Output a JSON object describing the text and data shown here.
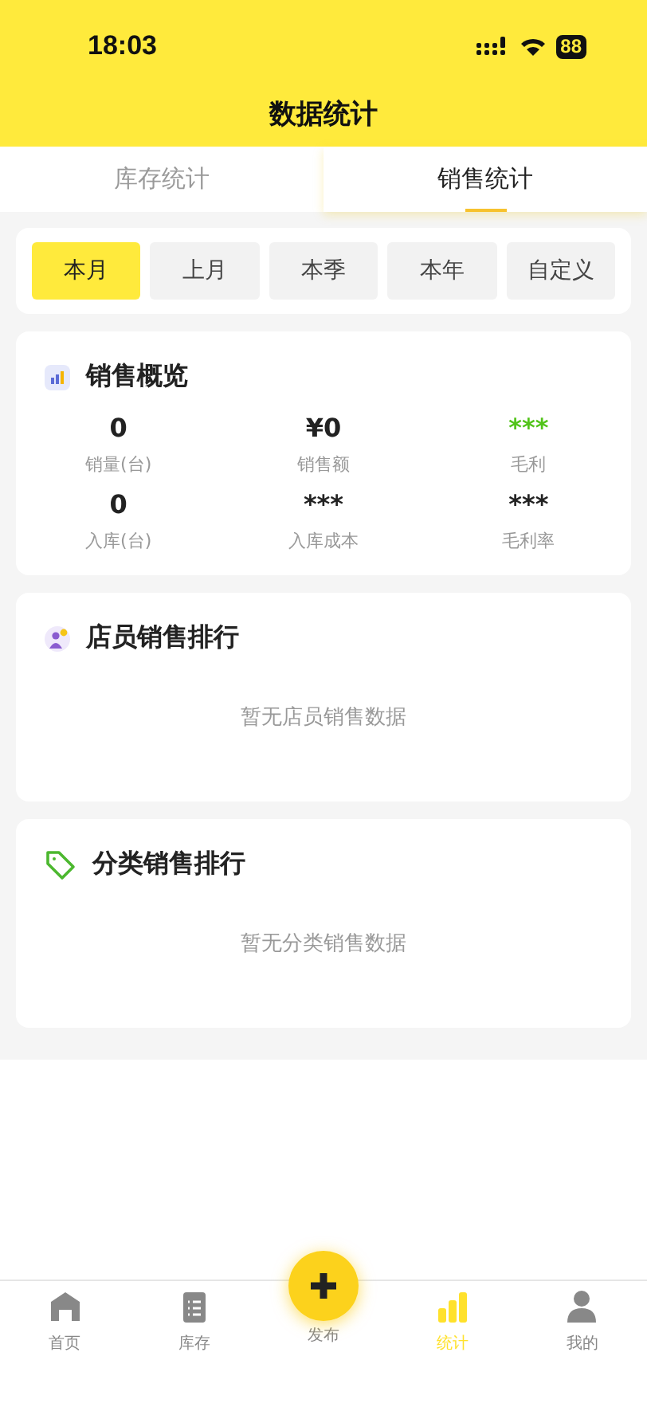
{
  "status_bar": {
    "time": "18:03",
    "battery": "88"
  },
  "header": {
    "title": "数据统计"
  },
  "tabs": [
    {
      "label": "库存统计",
      "selected": false
    },
    {
      "label": "销售统计",
      "selected": true
    }
  ],
  "periods": [
    {
      "label": "本月",
      "selected": true
    },
    {
      "label": "上月",
      "selected": false
    },
    {
      "label": "本季",
      "selected": false
    },
    {
      "label": "本年",
      "selected": false
    },
    {
      "label": "自定义",
      "selected": false
    }
  ],
  "overview": {
    "title": "销售概览",
    "metrics": [
      {
        "value": "0",
        "label": "销量(台)",
        "color": "#222222"
      },
      {
        "value": "¥0",
        "label": "销售额",
        "color": "#222222"
      },
      {
        "value": "***",
        "label": "毛利",
        "color": "#52c41a"
      },
      {
        "value": "0",
        "label": "入库(台)",
        "color": "#222222"
      },
      {
        "value": "***",
        "label": "入库成本",
        "color": "#222222"
      },
      {
        "value": "***",
        "label": "毛利率",
        "color": "#222222"
      }
    ]
  },
  "sections": [
    {
      "title": "店员销售排行",
      "empty_text": "暂无店员销售数据"
    },
    {
      "title": "分类销售排行",
      "empty_text": "暂无分类销售数据"
    }
  ],
  "tab_bar": [
    {
      "label": "首页",
      "selected": false
    },
    {
      "label": "库存",
      "selected": false
    },
    {
      "label": "发布",
      "selected": false,
      "kind": "action"
    },
    {
      "label": "统计",
      "selected": true
    },
    {
      "label": "我的",
      "selected": false
    }
  ]
}
